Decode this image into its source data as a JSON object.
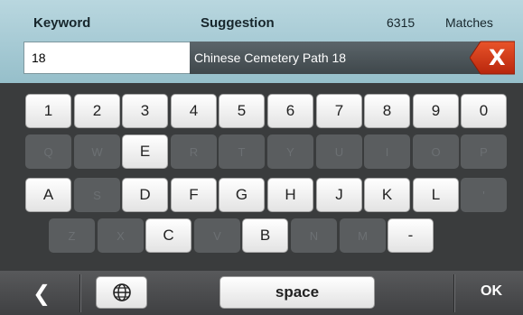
{
  "header": {
    "keyword_label": "Keyword",
    "suggestion_label": "Suggestion",
    "match_count": "6315",
    "matches_label": "Matches",
    "keyword_value": "18",
    "suggestion_value": "Chinese Cemetery Path 18",
    "clear_label": "X"
  },
  "keyboard": {
    "row1": [
      {
        "label": "1",
        "enabled": true
      },
      {
        "label": "2",
        "enabled": true
      },
      {
        "label": "3",
        "enabled": true
      },
      {
        "label": "4",
        "enabled": true
      },
      {
        "label": "5",
        "enabled": true
      },
      {
        "label": "6",
        "enabled": true
      },
      {
        "label": "7",
        "enabled": true
      },
      {
        "label": "8",
        "enabled": true
      },
      {
        "label": "9",
        "enabled": true
      },
      {
        "label": "0",
        "enabled": true
      }
    ],
    "row2": [
      {
        "label": "Q",
        "enabled": false
      },
      {
        "label": "W",
        "enabled": false
      },
      {
        "label": "E",
        "enabled": true
      },
      {
        "label": "R",
        "enabled": false
      },
      {
        "label": "T",
        "enabled": false
      },
      {
        "label": "Y",
        "enabled": false
      },
      {
        "label": "U",
        "enabled": false
      },
      {
        "label": "I",
        "enabled": false
      },
      {
        "label": "O",
        "enabled": false
      },
      {
        "label": "P",
        "enabled": false
      }
    ],
    "row3": [
      {
        "label": "A",
        "enabled": true
      },
      {
        "label": "S",
        "enabled": false
      },
      {
        "label": "D",
        "enabled": true
      },
      {
        "label": "F",
        "enabled": true
      },
      {
        "label": "G",
        "enabled": true
      },
      {
        "label": "H",
        "enabled": true
      },
      {
        "label": "J",
        "enabled": true
      },
      {
        "label": "K",
        "enabled": true
      },
      {
        "label": "L",
        "enabled": true
      },
      {
        "label": "'",
        "enabled": false
      }
    ],
    "row4": [
      {
        "label": "Z",
        "enabled": false
      },
      {
        "label": "X",
        "enabled": false
      },
      {
        "label": "C",
        "enabled": true
      },
      {
        "label": "V",
        "enabled": false
      },
      {
        "label": "B",
        "enabled": true
      },
      {
        "label": "N",
        "enabled": false
      },
      {
        "label": "M",
        "enabled": false
      },
      {
        "label": "-",
        "enabled": true
      }
    ]
  },
  "bottom": {
    "back_icon": "chevron-left-icon",
    "back_glyph": "❮",
    "globe_icon": "globe-icon",
    "space_label": "space",
    "ok_label": "OK"
  }
}
